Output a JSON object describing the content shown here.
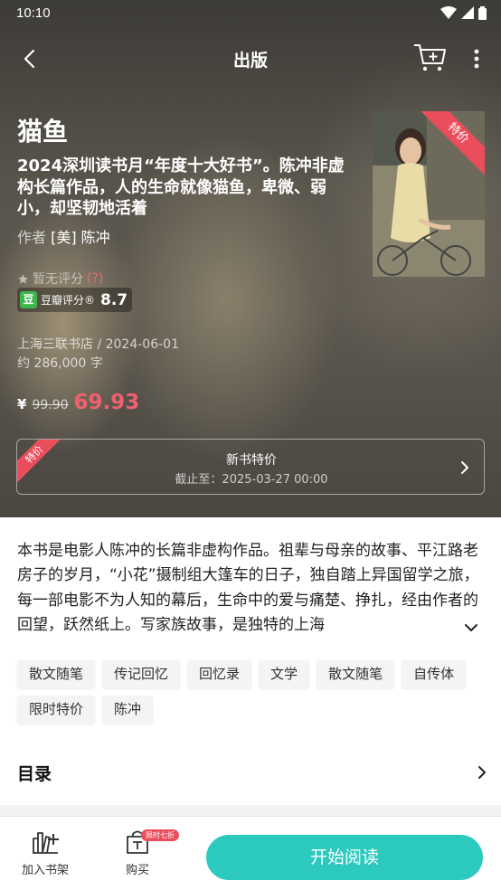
{
  "status_bar": {
    "time": "10:10"
  },
  "appbar": {
    "title": "出版"
  },
  "book": {
    "title": "猫鱼",
    "subtitle": "2024深圳读书月“年度十大好书”。陈冲非虚构长篇作品，人的生命就像猫鱼，卑微、弱小，却坚韧地活着",
    "author_label": "作者",
    "author_name": "[美] 陈冲",
    "cover_ribbon": "特价",
    "no_rating_text": "暂无评分",
    "no_rating_help": "(?)",
    "douban_logo": "豆",
    "douban_label": "豆瓣评分®",
    "douban_score": "8.7",
    "publisher": "上海三联书店 / 2024-06-01",
    "word_count": "约 286,000 字"
  },
  "price": {
    "currency": "¥",
    "original": "99.90",
    "current": "69.93"
  },
  "promo": {
    "ribbon": "特价",
    "title": "新书特价",
    "deadline": "截止至：2025-03-27 00:00"
  },
  "description": "本书是电影人陈冲的长篇非虚构作品。祖辈与母亲的故事、平江路老房子的岁月，“小花”摄制组大篷车的日子，独自踏上异国留学之旅，每一部电影不为人知的幕后，生命中的爱与痛楚、挣扎，经由作者的回望，跃然纸上。写家族故事，是独特的上海",
  "tags": [
    "散文随笔",
    "传记回忆",
    "回忆录",
    "文学",
    "散文随笔",
    "自传体",
    "限时特价",
    "陈冲"
  ],
  "toc": {
    "label": "目录"
  },
  "bottom_bar": {
    "shelf_label": "加入书架",
    "buy_label": "购买",
    "buy_badge": "限时七折",
    "read_label": "开始阅读"
  },
  "colors": {
    "accent": "#2cc9bf",
    "price": "#f0606e",
    "ribbon": "#ea4e5d",
    "douban": "#3cb64b"
  },
  "icons": [
    "back-icon",
    "cart-add-icon",
    "more-vertical-icon",
    "star-icon",
    "chevron-right-icon",
    "chevron-down-icon",
    "bookshelf-add-icon",
    "purchase-icon",
    "wifi-icon",
    "signal-icon",
    "battery-icon"
  ]
}
